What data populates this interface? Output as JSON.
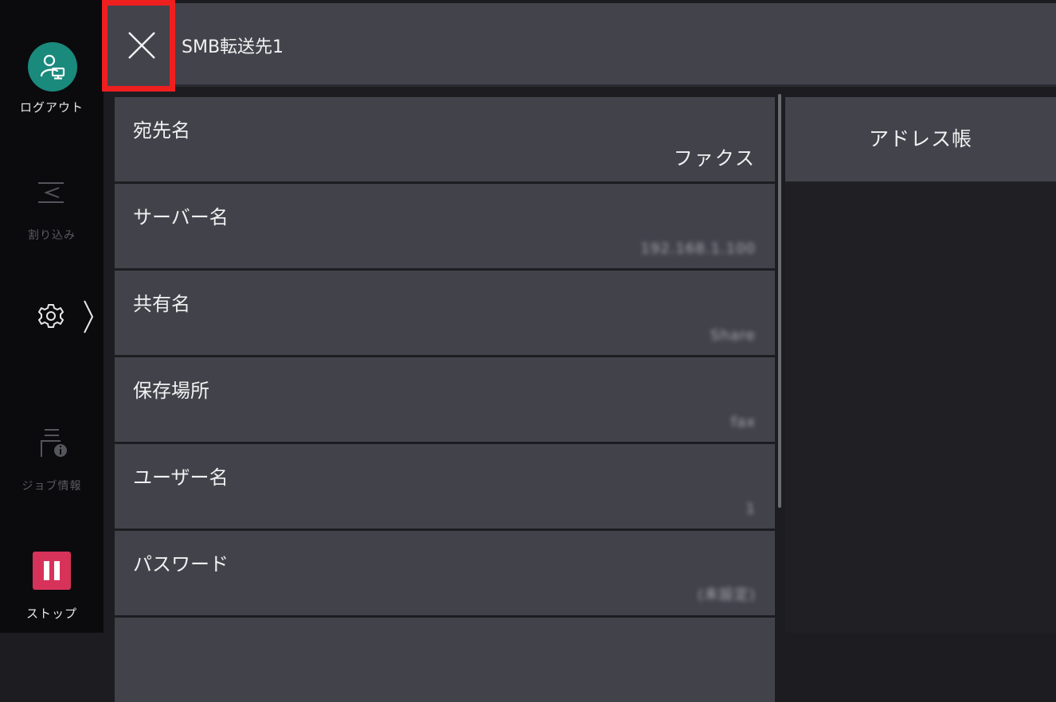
{
  "sidebar": {
    "logout_label": "ログアウト",
    "interrupt_label": "割り込み",
    "job_info_label": "ジョブ情報",
    "stop_label": "ストップ",
    "avatar_color": "#1a8a7c",
    "stop_color": "#d7325a"
  },
  "header": {
    "title": "SMB転送先1",
    "close_highlight_color": "#ee1f1f"
  },
  "fields": [
    {
      "label": "宛先名",
      "value": "ファクス"
    },
    {
      "label": "サーバー名",
      "value": "192.168.1.100"
    },
    {
      "label": "共有名",
      "value": "Share"
    },
    {
      "label": "保存場所",
      "value": "fax"
    },
    {
      "label": "ユーザー名",
      "value": "1"
    },
    {
      "label": "パスワード",
      "value": "(未設定)"
    },
    {
      "label": "",
      "value": ""
    }
  ],
  "right_panel": {
    "address_book_label": "アドレス帳"
  }
}
